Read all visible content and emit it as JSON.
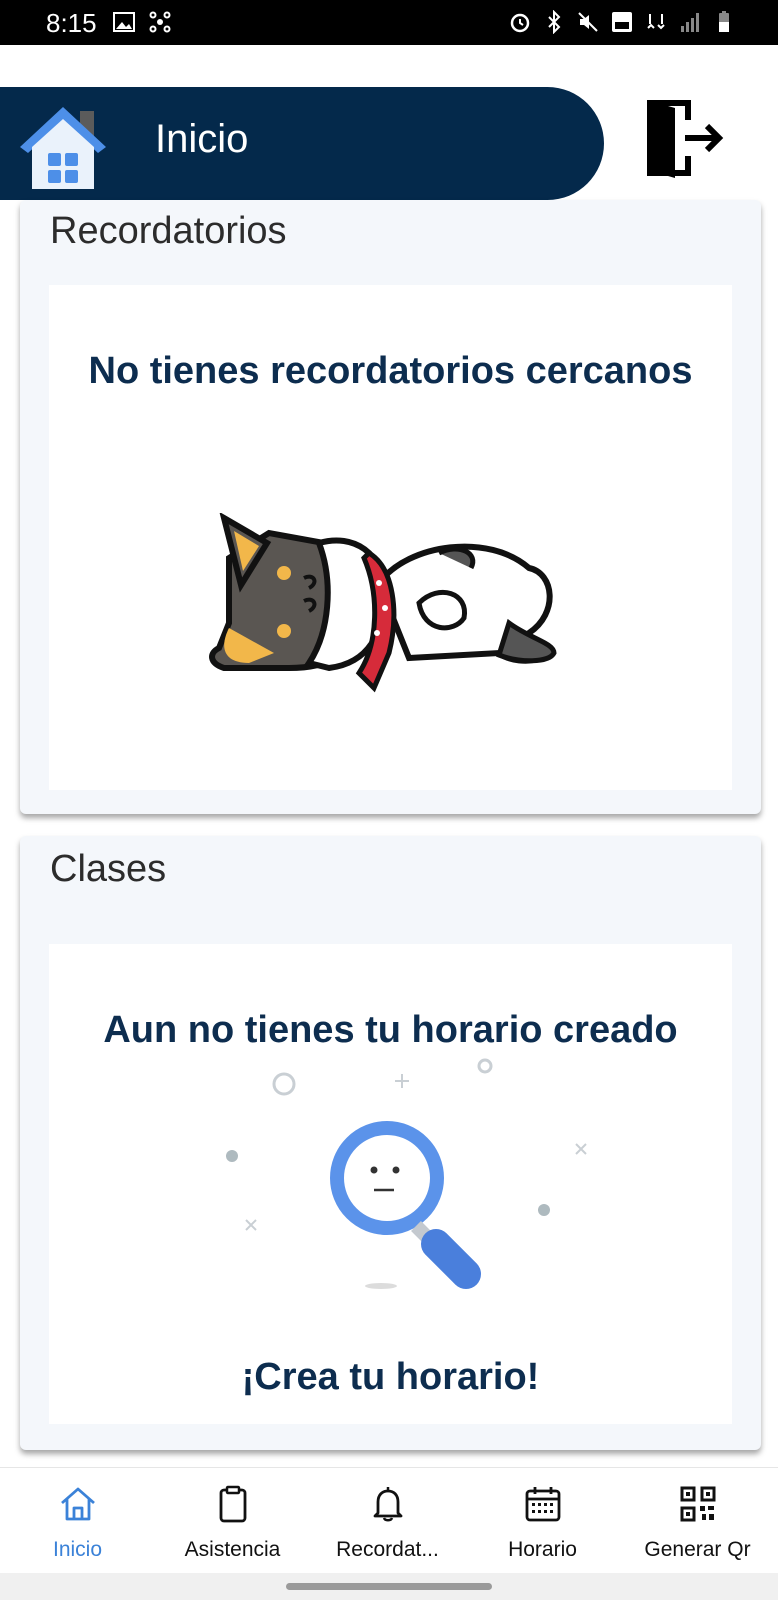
{
  "status_bar": {
    "time": "8:15"
  },
  "header": {
    "title": "Inicio"
  },
  "reminders": {
    "title": "Recordatorios",
    "empty_message": "No tienes recordatorios cercanos"
  },
  "classes": {
    "title": "Clases",
    "empty_message": "Aun no tienes tu horario creado",
    "cta": "¡Crea tu horario!"
  },
  "bottom_nav": {
    "items": [
      {
        "label": "Inicio",
        "icon": "home-icon",
        "active": true
      },
      {
        "label": "Asistencia",
        "icon": "clipboard-icon",
        "active": false
      },
      {
        "label": "Recordat...",
        "icon": "bell-icon",
        "active": false
      },
      {
        "label": "Horario",
        "icon": "calendar-icon",
        "active": false
      },
      {
        "label": "Generar Qr",
        "icon": "qr-code-icon",
        "active": false
      }
    ]
  },
  "colors": {
    "header_bg": "#04294b",
    "accent": "#3b82d8",
    "text_heading": "#0d2d4f"
  }
}
